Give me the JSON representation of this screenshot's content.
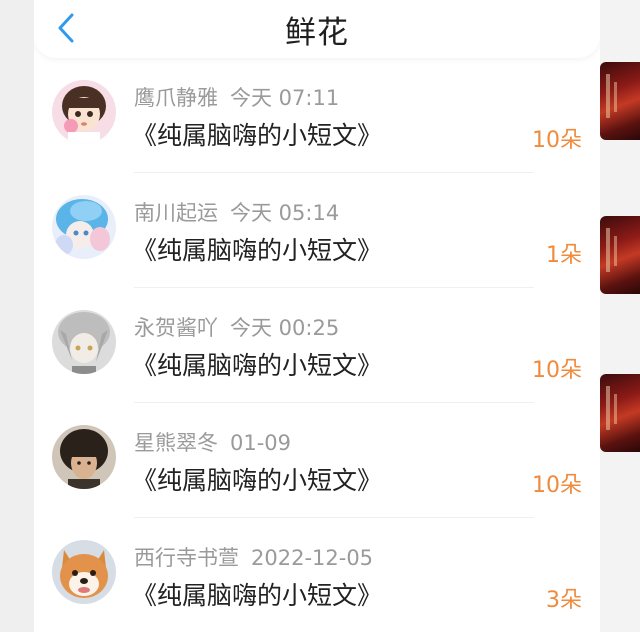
{
  "header": {
    "title": "鲜花",
    "back_icon": "chevron-left-icon"
  },
  "colors": {
    "accent": "#2e9bf0",
    "count": "#f08a3c",
    "name": "#9a9a9a",
    "text": "#222222"
  },
  "items": [
    {
      "name": "鹰爪静雅",
      "time": "今天 07:11",
      "work": "《纯属脑嗨的小短文》",
      "count": "10朵",
      "avatar": "anime-girl-avatar"
    },
    {
      "name": "南川起运",
      "time": "今天 05:14",
      "work": "《纯属脑嗨的小短文》",
      "count": "1朵",
      "avatar": "blue-hair-avatar"
    },
    {
      "name": "永贺酱吖",
      "time": "今天 00:25",
      "work": "《纯属脑嗨的小短文》",
      "count": "10朵",
      "avatar": "grey-hair-avatar"
    },
    {
      "name": "星熊翠冬",
      "time": "01-09",
      "work": "《纯属脑嗨的小短文》",
      "count": "10朵",
      "avatar": "photo-avatar"
    },
    {
      "name": "西行寺书萱",
      "time": "2022-12-05",
      "work": "《纯属脑嗨的小短文》",
      "count": "3朵",
      "avatar": "shiba-dog-avatar"
    }
  ]
}
